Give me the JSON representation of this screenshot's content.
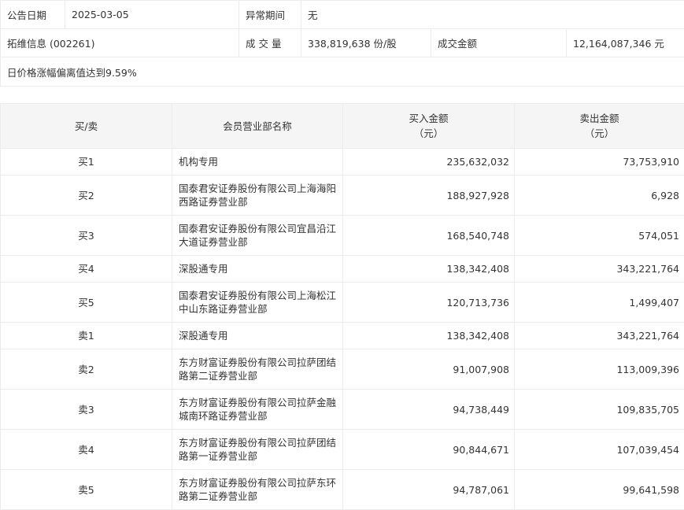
{
  "info": {
    "date_label": "公告日期",
    "date_value": "2025-03-05",
    "period_label": "异常期间",
    "period_value": "无",
    "stock_label": "拓维信息 (002261)",
    "volume_label": "成 交 量",
    "volume_value": "338,819,638 份/股",
    "amount_label": "成交金额",
    "amount_value": "12,164,087,346 元",
    "reason": "日价格涨幅偏离值达到9.59%"
  },
  "table": {
    "headers": {
      "side": "买/卖",
      "member": "会员营业部名称",
      "buy": "买入金额",
      "buy_unit": "（元）",
      "sell": "卖出金额",
      "sell_unit": "（元）"
    },
    "rows": [
      {
        "side": "买1",
        "name": "机构专用",
        "buy": "235,632,032",
        "sell": "73,753,910"
      },
      {
        "side": "买2",
        "name": "国泰君安证券股份有限公司上海海阳西路证券营业部",
        "buy": "188,927,928",
        "sell": "6,928"
      },
      {
        "side": "买3",
        "name": "国泰君安证券股份有限公司宜昌沿江大道证券营业部",
        "buy": "168,540,748",
        "sell": "574,051"
      },
      {
        "side": "买4",
        "name": "深股通专用",
        "buy": "138,342,408",
        "sell": "343,221,764"
      },
      {
        "side": "买5",
        "name": "国泰君安证券股份有限公司上海松江中山东路证券营业部",
        "buy": "120,713,736",
        "sell": "1,499,407"
      },
      {
        "side": "卖1",
        "name": "深股通专用",
        "buy": "138,342,408",
        "sell": "343,221,764"
      },
      {
        "side": "卖2",
        "name": "东方财富证券股份有限公司拉萨团结路第二证券营业部",
        "buy": "91,007,908",
        "sell": "113,009,396"
      },
      {
        "side": "卖3",
        "name": "东方财富证券股份有限公司拉萨金融城南环路证券营业部",
        "buy": "94,738,449",
        "sell": "109,835,705"
      },
      {
        "side": "卖4",
        "name": "东方财富证券股份有限公司拉萨团结路第一证券营业部",
        "buy": "90,844,671",
        "sell": "107,039,454"
      },
      {
        "side": "卖5",
        "name": "东方财富证券股份有限公司拉萨东环路第二证券营业部",
        "buy": "94,787,061",
        "sell": "99,641,598"
      }
    ]
  }
}
